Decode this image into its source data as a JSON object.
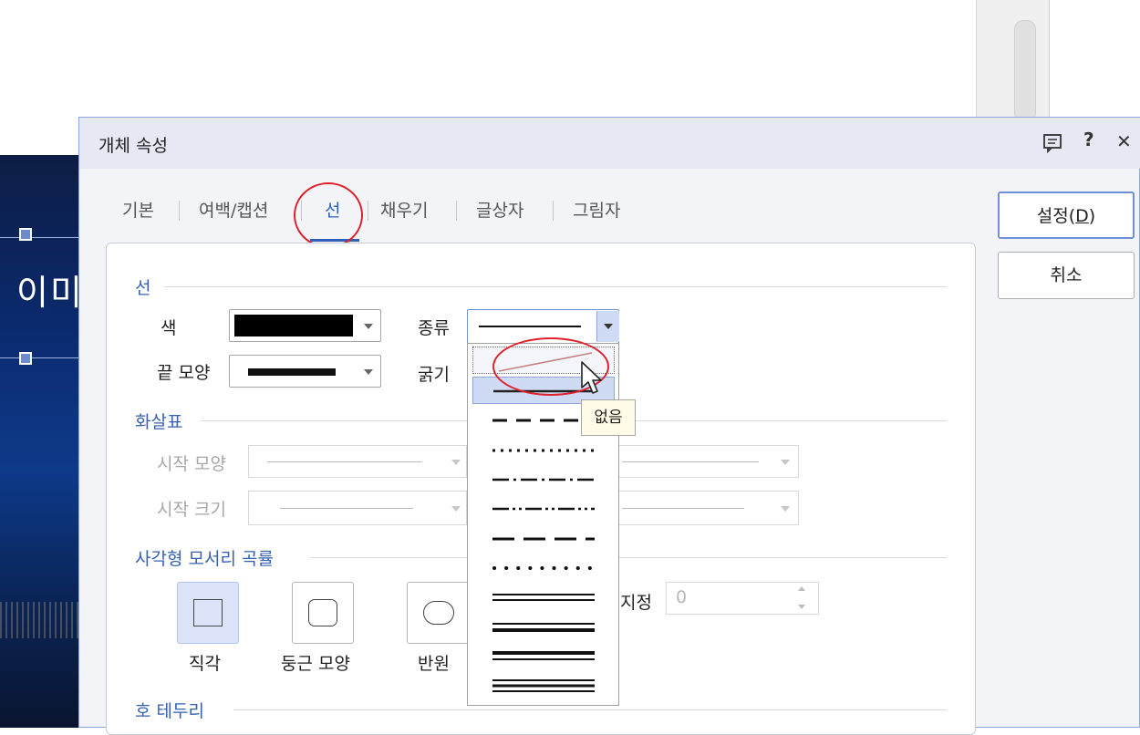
{
  "background": {
    "slide_text": "이미"
  },
  "dialog": {
    "title": "개체 속성",
    "titlebar_icons": [
      "comment-icon",
      "help-icon",
      "close-icon"
    ],
    "help_glyph": "?",
    "close_glyph": "✕",
    "tabs": [
      {
        "label": "기본",
        "active": false
      },
      {
        "label": "여백/캡션",
        "active": false
      },
      {
        "label": "선",
        "active": true
      },
      {
        "label": "채우기",
        "active": false
      },
      {
        "label": "글상자",
        "active": false
      },
      {
        "label": "그림자",
        "active": false
      }
    ],
    "buttons": {
      "ok": "설정(D)",
      "ok_mnemonic": "D",
      "cancel": "취소"
    },
    "line_section": {
      "heading": "선",
      "color_label": "색",
      "color_value": "#000000",
      "end_shape_label": "끝 모양",
      "type_label": "종류",
      "thickness_label": "굵기"
    },
    "arrow_section": {
      "heading": "화살표",
      "start_shape_label": "시작 모양",
      "start_size_label": "시작 크기"
    },
    "corner_section": {
      "heading": "사각형 모서리 곡률",
      "options": [
        "직각",
        "둥근 모양",
        "반원"
      ],
      "selected": "직각",
      "curvature_label_partial": "지정",
      "curvature_value": "0"
    },
    "arc_section": {
      "heading": "호 테두리"
    },
    "line_type_dropdown": {
      "items": [
        "없음",
        "solid",
        "dash",
        "dot",
        "dash-dot",
        "dash-dot-dot",
        "long-dash",
        "round-dot",
        "double",
        "thick-thin",
        "thin-thick",
        "triple"
      ],
      "hovered": "solid",
      "tooltip": "없음"
    }
  },
  "annotations": {
    "accent": "#e0222c",
    "selection": "#cfdaf5"
  }
}
